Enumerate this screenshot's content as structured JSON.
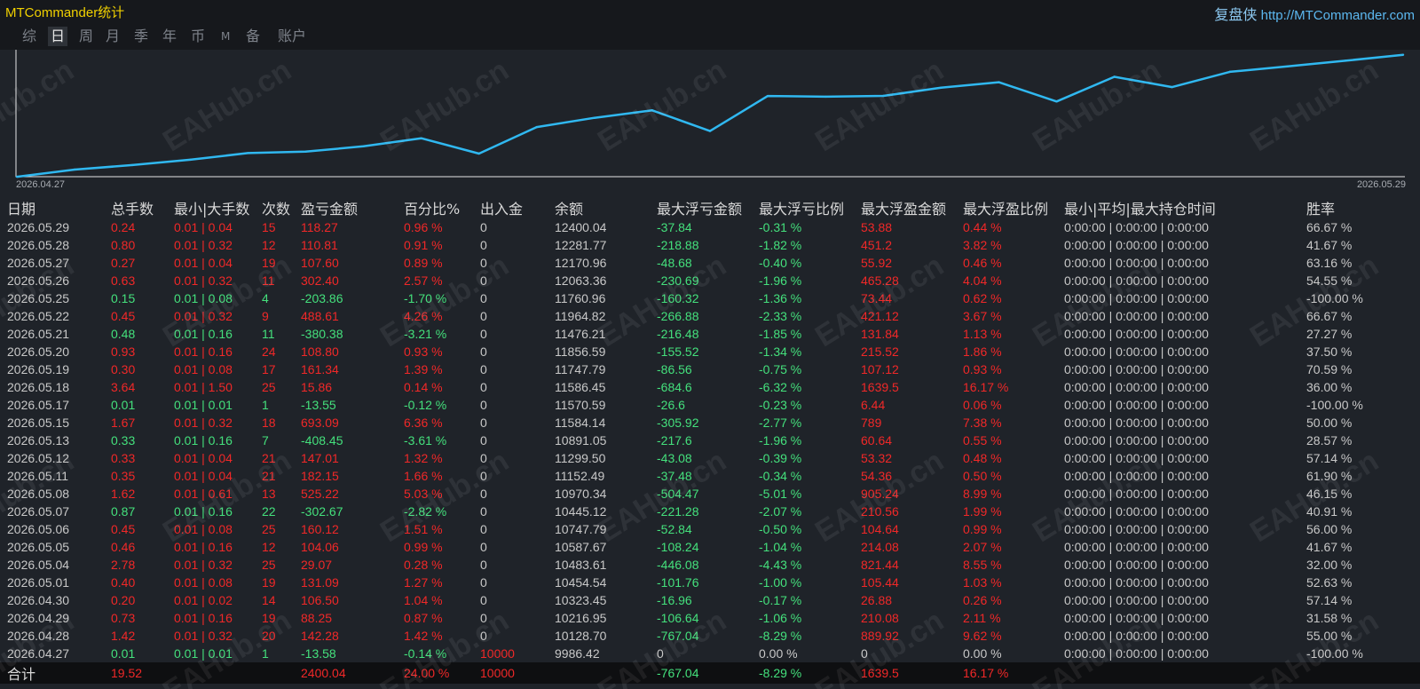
{
  "app": {
    "title": "MTCommander统计",
    "brand_cn": "复盘侠",
    "brand_url": "http://MTCommander.com"
  },
  "tabs": [
    "综",
    "日",
    "周",
    "月",
    "季",
    "年",
    "币",
    "M",
    "备",
    "账户"
  ],
  "active_tab": "日",
  "watermark": "EAHub.cn",
  "colors": {
    "positive": "#f02828",
    "negative": "#44e07c",
    "neutral": "#c8c8c8",
    "line": "#30b8f0",
    "title": "#f0d000"
  },
  "chart_data": {
    "type": "line",
    "x_start_label": "2026.04.27",
    "x_end_label": "2026.05.29",
    "x": [
      "2026.04.27",
      "2026.04.28",
      "2026.04.29",
      "2026.04.30",
      "2026.05.01",
      "2026.05.04",
      "2026.05.05",
      "2026.05.06",
      "2026.05.07",
      "2026.05.08",
      "2026.05.11",
      "2026.05.12",
      "2026.05.13",
      "2026.05.15",
      "2026.05.17",
      "2026.05.18",
      "2026.05.19",
      "2026.05.20",
      "2026.05.21",
      "2026.05.22",
      "2026.05.25",
      "2026.05.26",
      "2026.05.27",
      "2026.05.28",
      "2026.05.29"
    ],
    "values": [
      9986.42,
      10128.7,
      10216.95,
      10323.45,
      10454.54,
      10483.61,
      10587.67,
      10747.79,
      10445.12,
      10970.34,
      11152.49,
      11299.5,
      10891.05,
      11584.14,
      11570.59,
      11586.45,
      11747.79,
      11856.59,
      11476.21,
      11964.82,
      11760.96,
      12063.36,
      12170.96,
      12281.77,
      12400.04
    ]
  },
  "table": {
    "headers": [
      "日期",
      "总手数",
      "最小|大手数",
      "次数",
      "盈亏金额",
      "百分比%",
      "出入金",
      "余额",
      "最大浮亏金额",
      "最大浮亏比例",
      "最大浮盈金额",
      "最大浮盈比例",
      "最小|平均|最大持仓时间",
      "胜率"
    ],
    "rows": [
      [
        "2026.05.29",
        "0.24",
        "0.01 | 0.04",
        "15",
        "118.27",
        "0.96 %",
        "0",
        "12400.04",
        "-37.84",
        "-0.31 %",
        "53.88",
        "0.44 %",
        "0:00:00 | 0:00:00 | 0:00:00",
        "66.67 %"
      ],
      [
        "2026.05.28",
        "0.80",
        "0.01 | 0.32",
        "12",
        "110.81",
        "0.91 %",
        "0",
        "12281.77",
        "-218.88",
        "-1.82 %",
        "451.2",
        "3.82 %",
        "0:00:00 | 0:00:00 | 0:00:00",
        "41.67 %"
      ],
      [
        "2026.05.27",
        "0.27",
        "0.01 | 0.04",
        "19",
        "107.60",
        "0.89 %",
        "0",
        "12170.96",
        "-48.68",
        "-0.40 %",
        "55.92",
        "0.46 %",
        "0:00:00 | 0:00:00 | 0:00:00",
        "63.16 %"
      ],
      [
        "2026.05.26",
        "0.63",
        "0.01 | 0.32",
        "11",
        "302.40",
        "2.57 %",
        "0",
        "12063.36",
        "-230.69",
        "-1.96 %",
        "465.28",
        "4.04 %",
        "0:00:00 | 0:00:00 | 0:00:00",
        "54.55 %"
      ],
      [
        "2026.05.25",
        "0.15",
        "0.01 | 0.08",
        "4",
        "-203.86",
        "-1.70 %",
        "0",
        "11760.96",
        "-160.32",
        "-1.36 %",
        "73.44",
        "0.62 %",
        "0:00:00 | 0:00:00 | 0:00:00",
        "-100.00 %"
      ],
      [
        "2026.05.22",
        "0.45",
        "0.01 | 0.32",
        "9",
        "488.61",
        "4.26 %",
        "0",
        "11964.82",
        "-266.88",
        "-2.33 %",
        "421.12",
        "3.67 %",
        "0:00:00 | 0:00:00 | 0:00:00",
        "66.67 %"
      ],
      [
        "2026.05.21",
        "0.48",
        "0.01 | 0.16",
        "11",
        "-380.38",
        "-3.21 %",
        "0",
        "11476.21",
        "-216.48",
        "-1.85 %",
        "131.84",
        "1.13 %",
        "0:00:00 | 0:00:00 | 0:00:00",
        "27.27 %"
      ],
      [
        "2026.05.20",
        "0.93",
        "0.01 | 0.16",
        "24",
        "108.80",
        "0.93 %",
        "0",
        "11856.59",
        "-155.52",
        "-1.34 %",
        "215.52",
        "1.86 %",
        "0:00:00 | 0:00:00 | 0:00:00",
        "37.50 %"
      ],
      [
        "2026.05.19",
        "0.30",
        "0.01 | 0.08",
        "17",
        "161.34",
        "1.39 %",
        "0",
        "11747.79",
        "-86.56",
        "-0.75 %",
        "107.12",
        "0.93 %",
        "0:00:00 | 0:00:00 | 0:00:00",
        "70.59 %"
      ],
      [
        "2026.05.18",
        "3.64",
        "0.01 | 1.50",
        "25",
        "15.86",
        "0.14 %",
        "0",
        "11586.45",
        "-684.6",
        "-6.32 %",
        "1639.5",
        "16.17 %",
        "0:00:00 | 0:00:00 | 0:00:00",
        "36.00 %"
      ],
      [
        "2026.05.17",
        "0.01",
        "0.01 | 0.01",
        "1",
        "-13.55",
        "-0.12 %",
        "0",
        "11570.59",
        "-26.6",
        "-0.23 %",
        "6.44",
        "0.06 %",
        "0:00:00 | 0:00:00 | 0:00:00",
        "-100.00 %"
      ],
      [
        "2026.05.15",
        "1.67",
        "0.01 | 0.32",
        "18",
        "693.09",
        "6.36 %",
        "0",
        "11584.14",
        "-305.92",
        "-2.77 %",
        "789",
        "7.38 %",
        "0:00:00 | 0:00:00 | 0:00:00",
        "50.00 %"
      ],
      [
        "2026.05.13",
        "0.33",
        "0.01 | 0.16",
        "7",
        "-408.45",
        "-3.61 %",
        "0",
        "10891.05",
        "-217.6",
        "-1.96 %",
        "60.64",
        "0.55 %",
        "0:00:00 | 0:00:00 | 0:00:00",
        "28.57 %"
      ],
      [
        "2026.05.12",
        "0.33",
        "0.01 | 0.04",
        "21",
        "147.01",
        "1.32 %",
        "0",
        "11299.50",
        "-43.08",
        "-0.39 %",
        "53.32",
        "0.48 %",
        "0:00:00 | 0:00:00 | 0:00:00",
        "57.14 %"
      ],
      [
        "2026.05.11",
        "0.35",
        "0.01 | 0.04",
        "21",
        "182.15",
        "1.66 %",
        "0",
        "11152.49",
        "-37.48",
        "-0.34 %",
        "54.36",
        "0.50 %",
        "0:00:00 | 0:00:00 | 0:00:00",
        "61.90 %"
      ],
      [
        "2026.05.08",
        "1.62",
        "0.01 | 0.61",
        "13",
        "525.22",
        "5.03 %",
        "0",
        "10970.34",
        "-504.47",
        "-5.01 %",
        "905.24",
        "8.99 %",
        "0:00:00 | 0:00:00 | 0:00:00",
        "46.15 %"
      ],
      [
        "2026.05.07",
        "0.87",
        "0.01 | 0.16",
        "22",
        "-302.67",
        "-2.82 %",
        "0",
        "10445.12",
        "-221.28",
        "-2.07 %",
        "210.56",
        "1.99 %",
        "0:00:00 | 0:00:00 | 0:00:00",
        "40.91 %"
      ],
      [
        "2026.05.06",
        "0.45",
        "0.01 | 0.08",
        "25",
        "160.12",
        "1.51 %",
        "0",
        "10747.79",
        "-52.84",
        "-0.50 %",
        "104.64",
        "0.99 %",
        "0:00:00 | 0:00:00 | 0:00:00",
        "56.00 %"
      ],
      [
        "2026.05.05",
        "0.46",
        "0.01 | 0.16",
        "12",
        "104.06",
        "0.99 %",
        "0",
        "10587.67",
        "-108.24",
        "-1.04 %",
        "214.08",
        "2.07 %",
        "0:00:00 | 0:00:00 | 0:00:00",
        "41.67 %"
      ],
      [
        "2026.05.04",
        "2.78",
        "0.01 | 0.32",
        "25",
        "29.07",
        "0.28 %",
        "0",
        "10483.61",
        "-446.08",
        "-4.43 %",
        "821.44",
        "8.55 %",
        "0:00:00 | 0:00:00 | 0:00:00",
        "32.00 %"
      ],
      [
        "2026.05.01",
        "0.40",
        "0.01 | 0.08",
        "19",
        "131.09",
        "1.27 %",
        "0",
        "10454.54",
        "-101.76",
        "-1.00 %",
        "105.44",
        "1.03 %",
        "0:00:00 | 0:00:00 | 0:00:00",
        "52.63 %"
      ],
      [
        "2026.04.30",
        "0.20",
        "0.01 | 0.02",
        "14",
        "106.50",
        "1.04 %",
        "0",
        "10323.45",
        "-16.96",
        "-0.17 %",
        "26.88",
        "0.26 %",
        "0:00:00 | 0:00:00 | 0:00:00",
        "57.14 %"
      ],
      [
        "2026.04.29",
        "0.73",
        "0.01 | 0.16",
        "19",
        "88.25",
        "0.87 %",
        "0",
        "10216.95",
        "-106.64",
        "-1.06 %",
        "210.08",
        "2.11 %",
        "0:00:00 | 0:00:00 | 0:00:00",
        "31.58 %"
      ],
      [
        "2026.04.28",
        "1.42",
        "0.01 | 0.32",
        "20",
        "142.28",
        "1.42 %",
        "0",
        "10128.70",
        "-767.04",
        "-8.29 %",
        "889.92",
        "9.62 %",
        "0:00:00 | 0:00:00 | 0:00:00",
        "55.00 %"
      ],
      [
        "2026.04.27",
        "0.01",
        "0.01 | 0.01",
        "1",
        "-13.58",
        "-0.14 %",
        "10000",
        "9986.42",
        "0",
        "0.00 %",
        "0",
        "0.00 %",
        "0:00:00 | 0:00:00 | 0:00:00",
        "-100.00 %"
      ]
    ],
    "total": [
      "合计",
      "19.52",
      "",
      "",
      "2400.04",
      "24.00 %",
      "10000",
      "",
      "-767.04",
      "-8.29 %",
      "1639.5",
      "16.17 %",
      "",
      ""
    ]
  }
}
